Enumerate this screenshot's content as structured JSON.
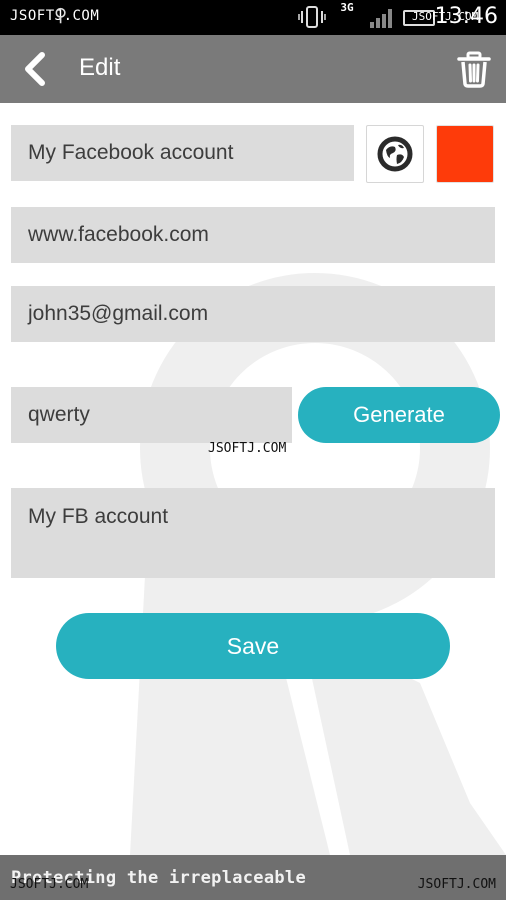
{
  "status_bar": {
    "watermark_left": "JSOFTJ.COM",
    "network": "3G",
    "watermark_right": "JSOFTJ.COM",
    "time": "13:46"
  },
  "app_bar": {
    "title": "Edit",
    "back_icon": "chevron-left-icon",
    "delete_icon": "trash-icon"
  },
  "form": {
    "name_value": "My Facebook account",
    "site_icon": "globe-icon",
    "color": "#fe3b0a",
    "url_value": "www.facebook.com",
    "login_value": "john35@gmail.com",
    "password_value": "qwerty",
    "generate_label": "Generate",
    "notes_value": "My FB account",
    "save_label": "Save"
  },
  "watermark_mid": "JSOFTJ.COM",
  "footer": {
    "tagline": "Protecting the irreplaceable",
    "watermark_left": "JSOFTJ.COM",
    "watermark_right": "JSOFTJ.COM"
  },
  "colors": {
    "accent": "#27b1bf",
    "app_bar": "#7a7a7a",
    "field_bg": "#dcdcdc"
  }
}
